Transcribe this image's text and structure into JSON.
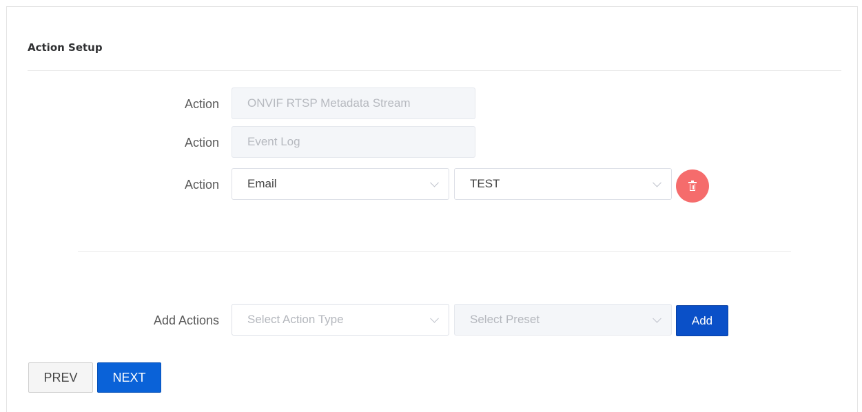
{
  "section": {
    "title": "Action Setup"
  },
  "actions": [
    {
      "label": "Action",
      "value": "ONVIF RTSP Metadata Stream",
      "state": "disabled"
    },
    {
      "label": "Action",
      "value": "Event Log",
      "state": "disabled"
    },
    {
      "label": "Action",
      "type_value": "Email",
      "preset_value": "TEST",
      "state": "editable",
      "delete_icon": "trash-icon"
    }
  ],
  "add_actions": {
    "label": "Add Actions",
    "type_placeholder": "Select Action Type",
    "preset_placeholder": "Select Preset",
    "add_label": "Add"
  },
  "footer": {
    "prev_label": "PREV",
    "next_label": "NEXT"
  },
  "colors": {
    "primary": "#0a62d8",
    "danger": "#f56c6c",
    "disabled_bg": "#f4f6f9"
  }
}
